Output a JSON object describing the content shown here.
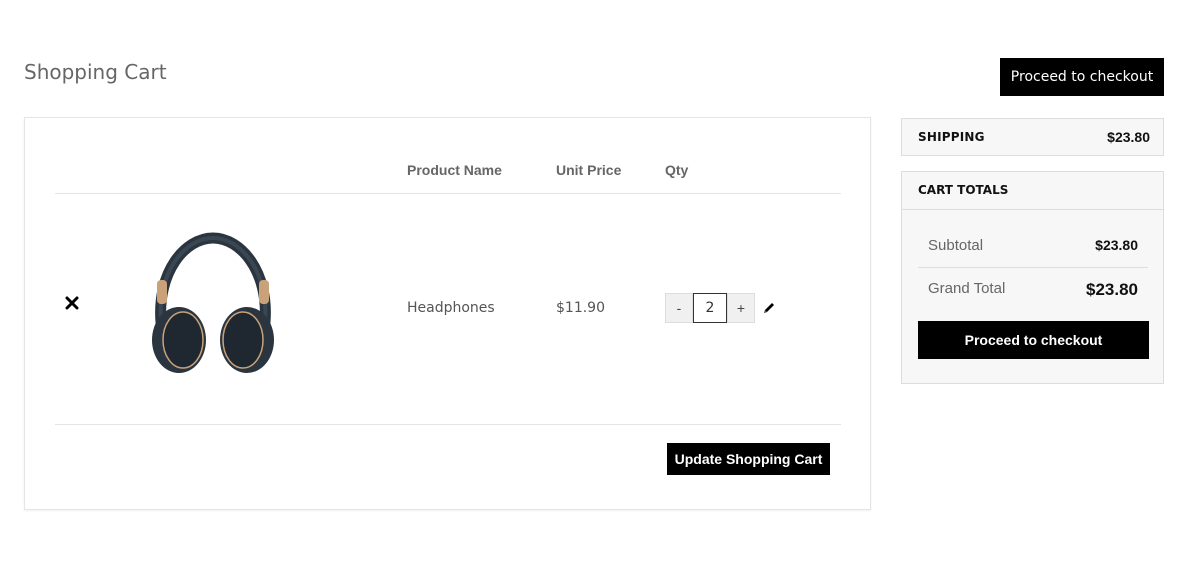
{
  "page": {
    "title": "Shopping Cart",
    "checkout_label": "Proceed to checkout"
  },
  "cart": {
    "columns": {
      "product_name": "Product Name",
      "unit_price": "Unit Price",
      "qty": "Qty"
    },
    "items": [
      {
        "name": "Headphones",
        "unit_price": "$11.90",
        "qty": "2",
        "image_icon": "headphones-image"
      }
    ],
    "qty_minus": "-",
    "qty_plus": "+",
    "update_label": "Update Shopping Cart"
  },
  "shipping": {
    "label": "SHIPPING",
    "value": "$23.80"
  },
  "totals": {
    "title": "CART TOTALS",
    "subtotal_label": "Subtotal",
    "subtotal_value": "$23.80",
    "grand_total_label": "Grand Total",
    "grand_total_value": "$23.80",
    "checkout_label": "Proceed to checkout"
  },
  "colors": {
    "button_bg": "#000000",
    "button_text": "#ffffff",
    "panel_border": "#e5e5e5"
  }
}
